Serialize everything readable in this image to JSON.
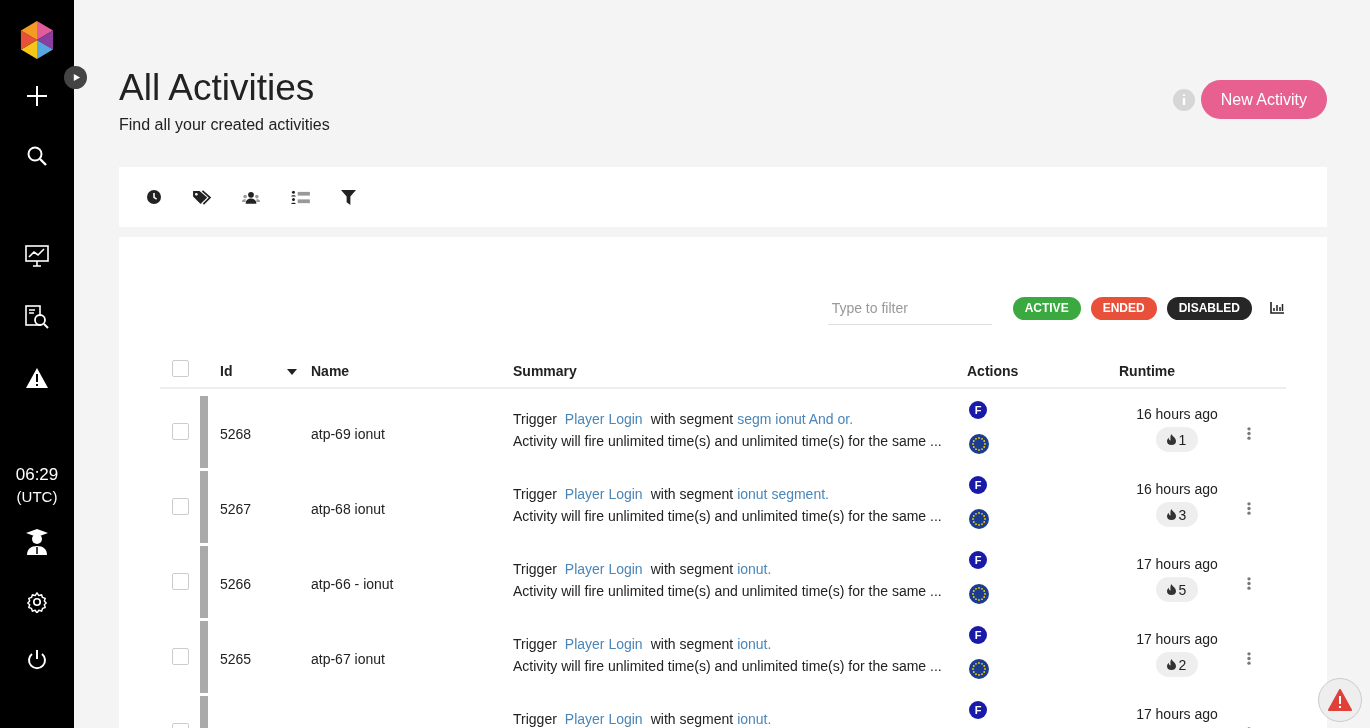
{
  "sidebar": {
    "time": "06:29",
    "timezone": "(UTC)"
  },
  "header": {
    "title": "All Activities",
    "subtitle": "Find all your created activities",
    "new_button": "New Activity"
  },
  "filter": {
    "placeholder": "Type to filter"
  },
  "status_filters": [
    {
      "label": "ACTIVE",
      "color": "#3aa93f"
    },
    {
      "label": "ENDED",
      "color": "#e8503a"
    },
    {
      "label": "DISABLED",
      "color": "#262626"
    }
  ],
  "table": {
    "all_selected": false,
    "columns": [
      {
        "label": "Id",
        "sorted": true
      },
      {
        "label": "Name",
        "sorted": false
      },
      {
        "label": "Summary",
        "sorted": false
      },
      {
        "label": "Actions",
        "sorted": false
      },
      {
        "label": "Runtime",
        "sorted": false
      }
    ],
    "rows": [
      {
        "id": "5268",
        "name": "atp-69 ionut",
        "checked": false,
        "lead": "Trigger",
        "trigger": "Player Login",
        "mid": "with segment",
        "segment": "segm ionut And or.",
        "detail": "Activity will fire unlimited time(s) and unlimited time(s) for the same ...",
        "badge": "F",
        "runtime": "16 hours ago",
        "fires": "1"
      },
      {
        "id": "5267",
        "name": "atp-68 ionut",
        "checked": false,
        "lead": "Trigger",
        "trigger": "Player Login",
        "mid": "with segment",
        "segment": "ionut segment.",
        "detail": "Activity will fire unlimited time(s) and unlimited time(s) for the same ...",
        "badge": "F",
        "runtime": "16 hours ago",
        "fires": "3"
      },
      {
        "id": "5266",
        "name": "atp-66 - ionut",
        "checked": false,
        "lead": "Trigger",
        "trigger": "Player Login",
        "mid": "with segment",
        "segment": "ionut.",
        "detail": "Activity will fire unlimited time(s) and unlimited time(s) for the same ...",
        "badge": "F",
        "runtime": "17 hours ago",
        "fires": "5"
      },
      {
        "id": "5265",
        "name": "atp-67 ionut",
        "checked": false,
        "lead": "Trigger",
        "trigger": "Player Login",
        "mid": "with segment",
        "segment": "ionut.",
        "detail": "Activity will fire unlimited time(s) and unlimited time(s) for the same ...",
        "badge": "F",
        "runtime": "17 hours ago",
        "fires": "2"
      },
      {
        "checked": false,
        "lead": "Trigger",
        "trigger": "Player Login",
        "mid": "with segment",
        "segment": "ionut.",
        "badge": "F",
        "runtime": "17 hours ago"
      }
    ]
  }
}
